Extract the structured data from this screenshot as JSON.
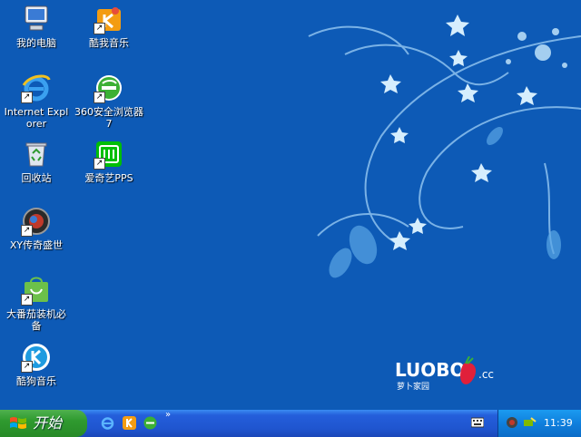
{
  "desktop": {
    "icons": [
      {
        "label": "我的电脑",
        "icon": "my-computer-icon"
      },
      {
        "label": "酷我音乐",
        "icon": "kuwo-music-icon"
      },
      {
        "label": "Internet Explorer",
        "icon": "internet-explorer-icon"
      },
      {
        "label": "360安全浏览器7",
        "icon": "360-browser-icon"
      },
      {
        "label": "回收站",
        "icon": "recycle-bin-icon"
      },
      {
        "label": "爱奇艺PPS",
        "icon": "iqiyi-icon"
      },
      {
        "label": "XY传奇盛世",
        "icon": "xy-game-icon"
      },
      {
        "label": "大番茄装机必备",
        "icon": "shopping-bag-icon"
      },
      {
        "label": "酷狗音乐",
        "icon": "kugou-music-icon"
      }
    ],
    "logo": {
      "brand": "LUOBO",
      "suffix": ".cc",
      "caption": "萝卜家园"
    }
  },
  "taskbar": {
    "start_label": "开始",
    "quicklaunch_more": "»",
    "clock": "11:39"
  },
  "colors": {
    "desktop_bg": "#0d5ab6",
    "taskbar": "#245edb",
    "start_button": "#2f9a2f",
    "tray": "#0f7fdd"
  }
}
